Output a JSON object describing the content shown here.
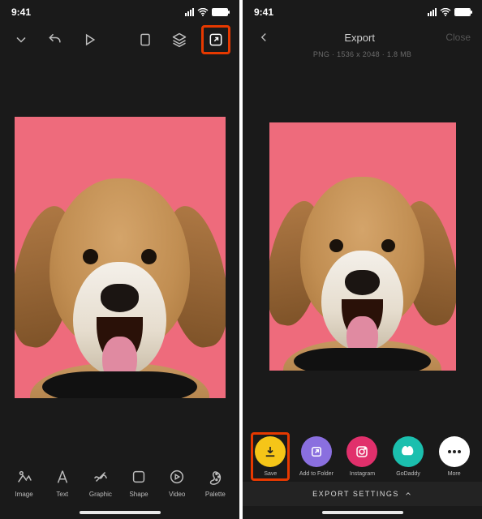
{
  "status": {
    "time": "9:41"
  },
  "editor": {
    "tools": [
      {
        "label": "Image"
      },
      {
        "label": "Text"
      },
      {
        "label": "Graphic"
      },
      {
        "label": "Shape"
      },
      {
        "label": "Video"
      },
      {
        "label": "Palette"
      }
    ]
  },
  "export": {
    "title": "Export",
    "close": "Close",
    "meta": "PNG · 1536 x 2048 · 1.8 MB",
    "actions": [
      {
        "label": "Save"
      },
      {
        "label": "Add to Folder"
      },
      {
        "label": "Instagram"
      },
      {
        "label": "GoDaddy"
      },
      {
        "label": "More"
      }
    ],
    "settings": "EXPORT SETTINGS"
  }
}
